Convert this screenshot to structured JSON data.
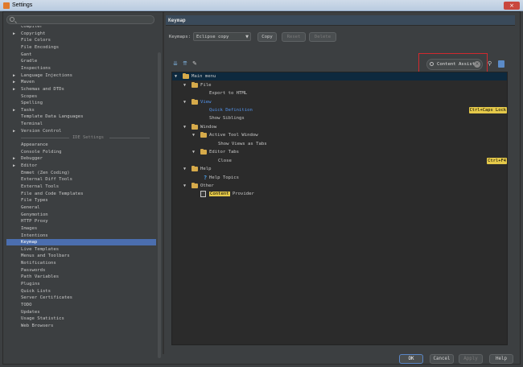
{
  "window": {
    "title": "Settings",
    "close_label": "×"
  },
  "sidebar": {
    "search_placeholder": "",
    "items": [
      {
        "label": "Compiler",
        "arrow": ""
      },
      {
        "label": "Copyright",
        "arrow": "▶"
      },
      {
        "label": "File Colors",
        "arrow": ""
      },
      {
        "label": "File Encodings",
        "arrow": ""
      },
      {
        "label": "Gant",
        "arrow": ""
      },
      {
        "label": "Gradle",
        "arrow": ""
      },
      {
        "label": "Inspections",
        "arrow": ""
      },
      {
        "label": "Language Injections",
        "arrow": "▶"
      },
      {
        "label": "Maven",
        "arrow": "▶"
      },
      {
        "label": "Schemas and DTDs",
        "arrow": "▶"
      },
      {
        "label": "Scopes",
        "arrow": ""
      },
      {
        "label": "Spelling",
        "arrow": ""
      },
      {
        "label": "Tasks",
        "arrow": "▶"
      },
      {
        "label": "Template Data Languages",
        "arrow": ""
      },
      {
        "label": "Terminal",
        "arrow": ""
      },
      {
        "label": "Version Control",
        "arrow": "▶"
      }
    ],
    "ide_separator": "IDE Settings",
    "ide_items": [
      {
        "label": "Appearance",
        "arrow": ""
      },
      {
        "label": "Console Folding",
        "arrow": ""
      },
      {
        "label": "Debugger",
        "arrow": "▶"
      },
      {
        "label": "Editor",
        "arrow": "▶"
      },
      {
        "label": "Emmet (Zen Coding)",
        "arrow": ""
      },
      {
        "label": "External Diff Tools",
        "arrow": ""
      },
      {
        "label": "External Tools",
        "arrow": ""
      },
      {
        "label": "File and Code Templates",
        "arrow": ""
      },
      {
        "label": "File Types",
        "arrow": ""
      },
      {
        "label": "General",
        "arrow": ""
      },
      {
        "label": "Genymotion",
        "arrow": ""
      },
      {
        "label": "HTTP Proxy",
        "arrow": ""
      },
      {
        "label": "Images",
        "arrow": ""
      },
      {
        "label": "Intentions",
        "arrow": ""
      },
      {
        "label": "Keymap",
        "arrow": "",
        "selected": true
      },
      {
        "label": "Live Templates",
        "arrow": ""
      },
      {
        "label": "Menus and Toolbars",
        "arrow": ""
      },
      {
        "label": "Notifications",
        "arrow": ""
      },
      {
        "label": "Passwords",
        "arrow": ""
      },
      {
        "label": "Path Variables",
        "arrow": ""
      },
      {
        "label": "Plugins",
        "arrow": ""
      },
      {
        "label": "Quick Lists",
        "arrow": ""
      },
      {
        "label": "Server Certificates",
        "arrow": ""
      },
      {
        "label": "TODO",
        "arrow": ""
      },
      {
        "label": "Updates",
        "arrow": ""
      },
      {
        "label": "Usage Statistics",
        "arrow": ""
      },
      {
        "label": "Web Browsers",
        "arrow": ""
      }
    ]
  },
  "panel": {
    "header": "Keymap",
    "keymap_label": "Keymaps:",
    "keymap_value": "Eclipse copy",
    "copy_label": "Copy",
    "reset_label": "Reset",
    "delete_label": "Delete",
    "filter_text": "Content Assist",
    "actions": [
      {
        "text": "Main menu",
        "twisty": "▼",
        "folder": true,
        "selected": true
      },
      {
        "text": "File",
        "twisty": "▼",
        "folder": true
      },
      {
        "text": "Export to HTML",
        "twisty": "",
        "folder": false
      },
      {
        "text": "View",
        "twisty": "▼",
        "folder": true,
        "blue": true
      },
      {
        "text": "Quick Definition",
        "twisty": "",
        "folder": false,
        "blue": true,
        "shortcut": "Ctrl+Caps Lock"
      },
      {
        "text": "Show Siblings",
        "twisty": "",
        "folder": false
      },
      {
        "text": "Window",
        "twisty": "▼",
        "folder": true
      },
      {
        "text": "Active Tool Window",
        "twisty": "▼",
        "folder": true
      },
      {
        "text": "Show Views as Tabs",
        "twisty": "",
        "folder": false
      },
      {
        "text": "Editor Tabs",
        "twisty": "▼",
        "folder": true
      },
      {
        "text": "Close",
        "twisty": "",
        "folder": false,
        "shortcut": "Ctrl+F4"
      },
      {
        "text": "Help",
        "twisty": "▼",
        "folder": true
      },
      {
        "text": "Help Topics",
        "twisty": "",
        "folder": false,
        "help": true
      },
      {
        "text": "Other",
        "twisty": "▼",
        "folder": true
      },
      {
        "text_hl": "Content",
        "text_rest": " Provider",
        "twisty": "",
        "folder": false,
        "page": true
      }
    ]
  },
  "footer": {
    "ok_label": "OK",
    "cancel_label": "Cancel",
    "apply_label": "Apply",
    "help_label": "Help"
  }
}
